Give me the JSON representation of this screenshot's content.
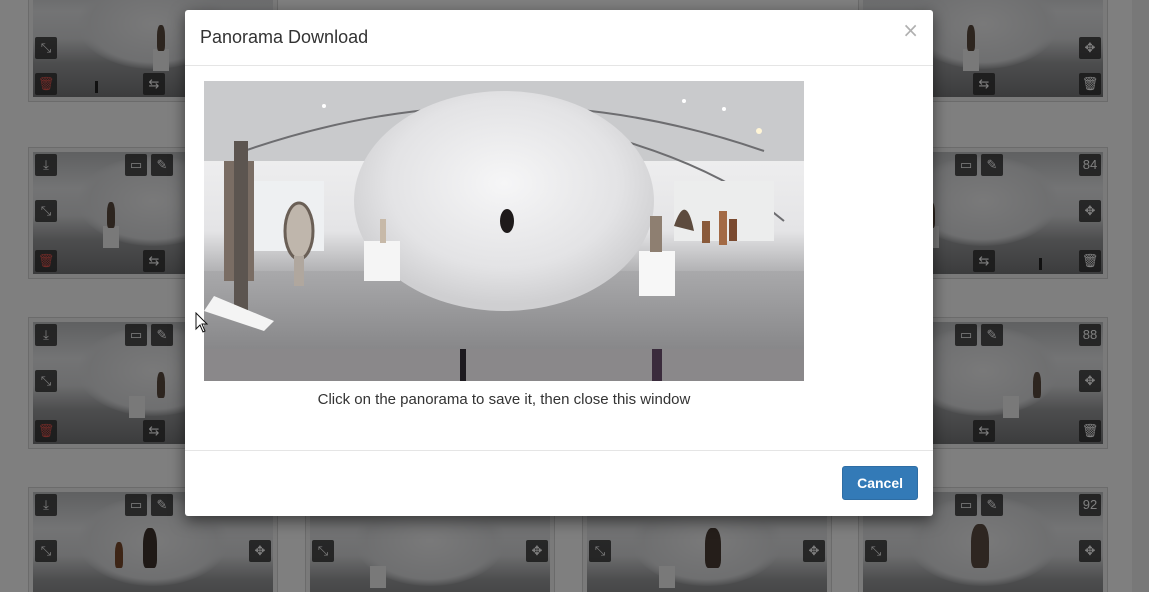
{
  "modal": {
    "title": "Panorama Download",
    "close_glyph": "×",
    "caption": "Click on the panorama to save it, then close this window",
    "cancel_label": "Cancel"
  },
  "background_cards": {
    "badge_numbers": [
      "84",
      "88",
      "92"
    ],
    "icons": [
      "download-icon",
      "ruler-icon",
      "edit-icon",
      "compress-icon",
      "move-icon",
      "swap-icon",
      "trash-icon"
    ]
  },
  "colors": {
    "primary_button": "#337ab7",
    "delete_icon": "#e0554f",
    "backdrop": "rgba(0,0,0,0.5)"
  }
}
